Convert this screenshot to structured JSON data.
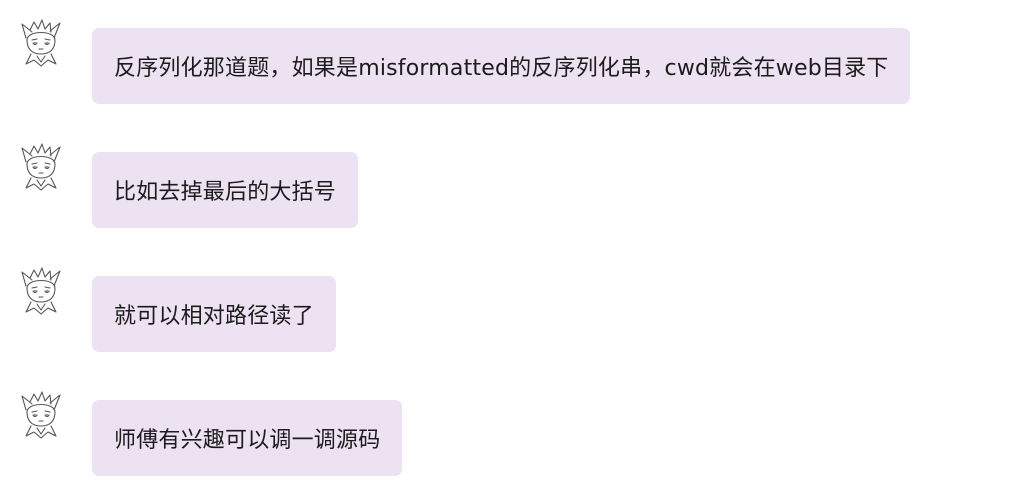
{
  "chat": {
    "messages": [
      {
        "text": "反序列化那道题，如果是misformatted的反序列化串，cwd就会在web目录下"
      },
      {
        "text": "比如去掉最后的大括号"
      },
      {
        "text": "就可以相对路径读了"
      },
      {
        "text": "师傅有兴趣可以调一调源码"
      }
    ],
    "sender": {
      "avatar_icon": "anime-character-sketch-avatar-icon"
    }
  },
  "colors": {
    "bubble_background": "#ece2f1",
    "text": "#1b1b1b",
    "page_background": "#ffffff"
  }
}
